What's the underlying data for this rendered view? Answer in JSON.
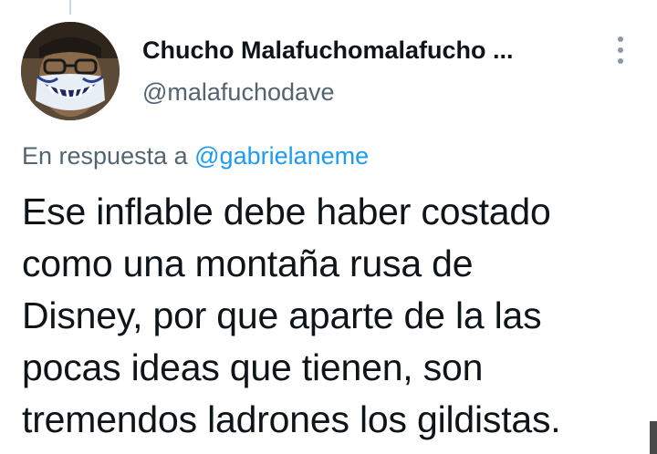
{
  "author": {
    "display_name": "Chucho Malafuchomalafucho ...",
    "handle": "@malafuchodave",
    "avatar_icon": "masked-user-avatar"
  },
  "reply": {
    "prefix": "En respuesta a",
    "mention": "@gabrielaneme"
  },
  "tweet": {
    "lines": [
      "Ese inflable debe haber costado",
      "como una montaña rusa de",
      "Disney, por que aparte de la las",
      "pocas ideas que tienen, son",
      "tremendos ladrones los gildistas."
    ]
  },
  "colors": {
    "text": "#0f1419",
    "secondary": "#536471",
    "link": "#1d9bf0"
  },
  "menu_icon": "more-vertical-icon"
}
